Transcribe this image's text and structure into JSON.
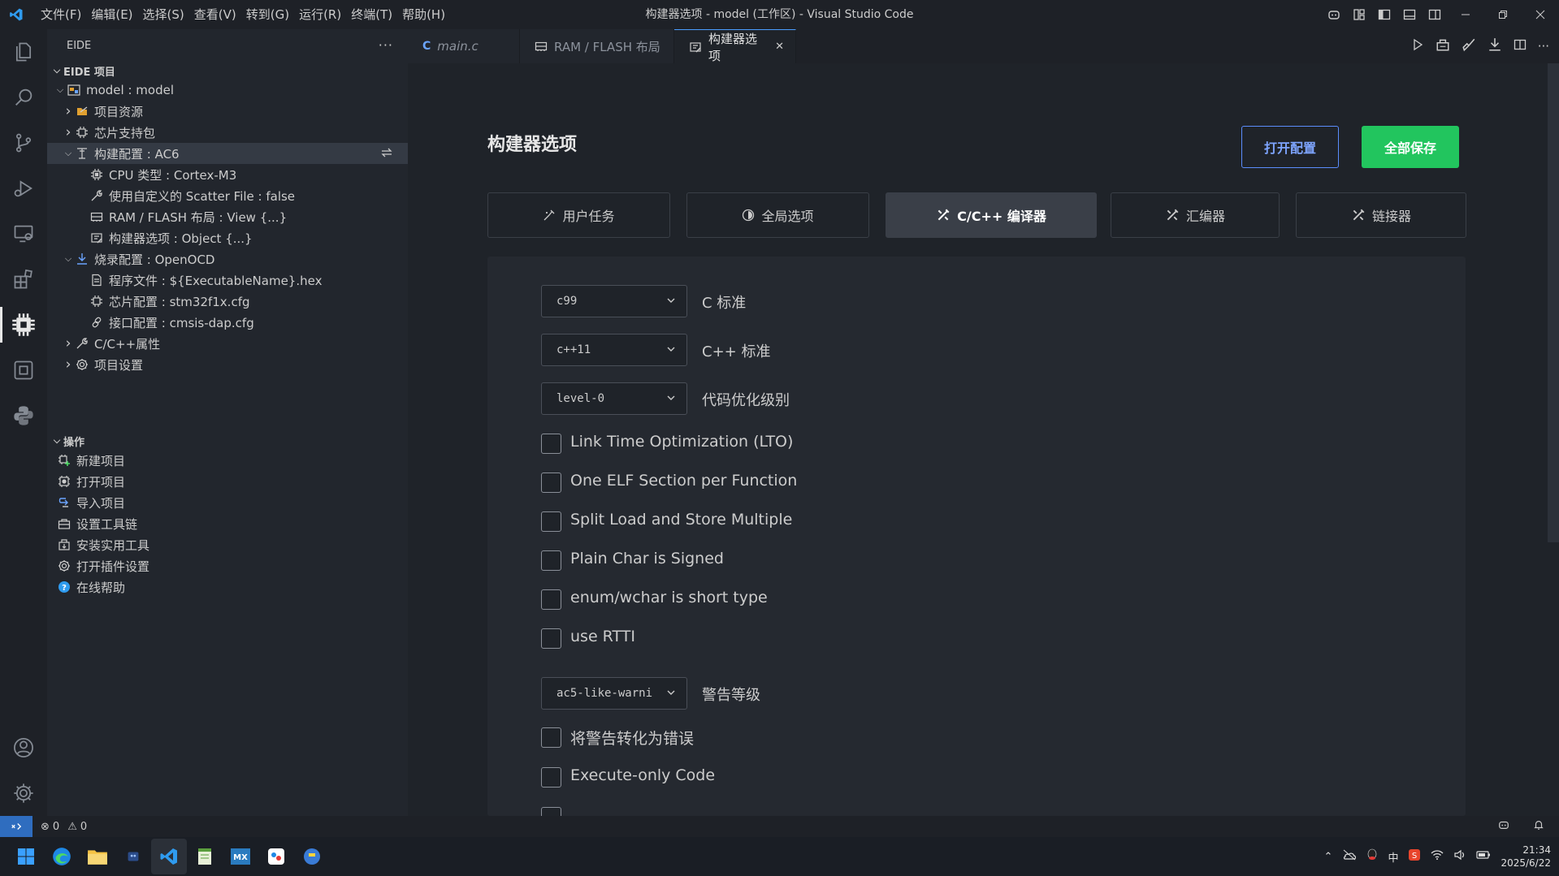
{
  "titlebar": {
    "menus": [
      "文件(F)",
      "编辑(E)",
      "选择(S)",
      "查看(V)",
      "转到(G)",
      "运行(R)",
      "终端(T)",
      "帮助(H)"
    ],
    "title": "构建器选项 - model (工作区) - Visual Studio Code"
  },
  "sidebar": {
    "header": "EIDE",
    "more": "···",
    "project_section": "EIDE 项目",
    "tree": [
      {
        "label": "model : model",
        "icon": "project-icon",
        "indent": 1,
        "chev": "down"
      },
      {
        "label": "项目资源",
        "icon": "resources-icon",
        "indent": 2,
        "chev": "right"
      },
      {
        "label": "芯片支持包",
        "icon": "chip-icon",
        "indent": 2,
        "chev": "right"
      },
      {
        "label": "构建配置 : AC6",
        "icon": "build-config-icon",
        "indent": 2,
        "chev": "down",
        "selected": true
      },
      {
        "label": "CPU 类型 : Cortex-M3",
        "icon": "cpu-icon",
        "indent": 3
      },
      {
        "label": "使用自定义的 Scatter File : false",
        "icon": "wrench-icon",
        "indent": 3
      },
      {
        "label": "RAM / FLASH 布局 : View {...}",
        "icon": "memory-icon",
        "indent": 3
      },
      {
        "label": "构建器选项 : Object {...}",
        "icon": "builder-options-icon",
        "indent": 3
      },
      {
        "label": "烧录配置 : OpenOCD",
        "icon": "download-icon",
        "indent": 2,
        "chev": "down"
      },
      {
        "label": "程序文件 : ${ExecutableName}.hex",
        "icon": "file-icon",
        "indent": 3
      },
      {
        "label": "芯片配置 : stm32f1x.cfg",
        "icon": "chip-icon",
        "indent": 3
      },
      {
        "label": "接口配置 : cmsis-dap.cfg",
        "icon": "link-icon",
        "indent": 3
      },
      {
        "label": "C/C++属性",
        "icon": "wrench-icon",
        "indent": 2,
        "chev": "right"
      },
      {
        "label": "项目设置",
        "icon": "gear-icon",
        "indent": 2,
        "chev": "right"
      }
    ],
    "ops_section": "操作",
    "ops": [
      {
        "label": "新建项目",
        "icon": "new-project-icon"
      },
      {
        "label": "打开项目",
        "icon": "open-project-icon"
      },
      {
        "label": "导入项目",
        "icon": "import-project-icon"
      },
      {
        "label": "设置工具链",
        "icon": "toolchain-icon"
      },
      {
        "label": "安装实用工具",
        "icon": "install-tools-icon"
      },
      {
        "label": "打开插件设置",
        "icon": "gear-icon"
      },
      {
        "label": "在线帮助",
        "icon": "help-icon"
      }
    ]
  },
  "tabs": [
    {
      "label": "main.c",
      "icon": "c-file-icon"
    },
    {
      "label": "RAM / FLASH 布局",
      "icon": "memory-icon"
    },
    {
      "label": "构建器选项",
      "icon": "builder-options-icon",
      "active": true
    }
  ],
  "page": {
    "title": "构建器选项",
    "open_config": "打开配置",
    "save_all": "全部保存",
    "config_tabs": [
      "用户任务",
      "全局选项",
      "C/C++ 编译器",
      "汇编器",
      "链接器"
    ],
    "active_config_tab": "C/C++ 编译器",
    "selects": [
      {
        "value": "c99",
        "label": "C 标准"
      },
      {
        "value": "c++11",
        "label": "C++ 标准"
      },
      {
        "value": "level-0",
        "label": "代码优化级别"
      }
    ],
    "checkboxes1": [
      "Link Time Optimization (LTO)",
      "One ELF Section per Function",
      "Split Load and Store Multiple",
      "Plain Char is Signed",
      "enum/wchar is short type",
      "use RTTI"
    ],
    "warning_select": {
      "value": "ac5-like-warni",
      "label": "警告等级"
    },
    "checkboxes2": [
      "将警告转化为错误",
      "Execute-only Code"
    ]
  },
  "statusbar": {
    "errors": "0",
    "warnings": "0"
  },
  "taskbar": {
    "ime": "中",
    "time": "21:34",
    "date": "2025/6/22"
  },
  "colors": {
    "accent": "#22c55e",
    "link": "#5b8dfc",
    "bg": "#1f2329"
  }
}
